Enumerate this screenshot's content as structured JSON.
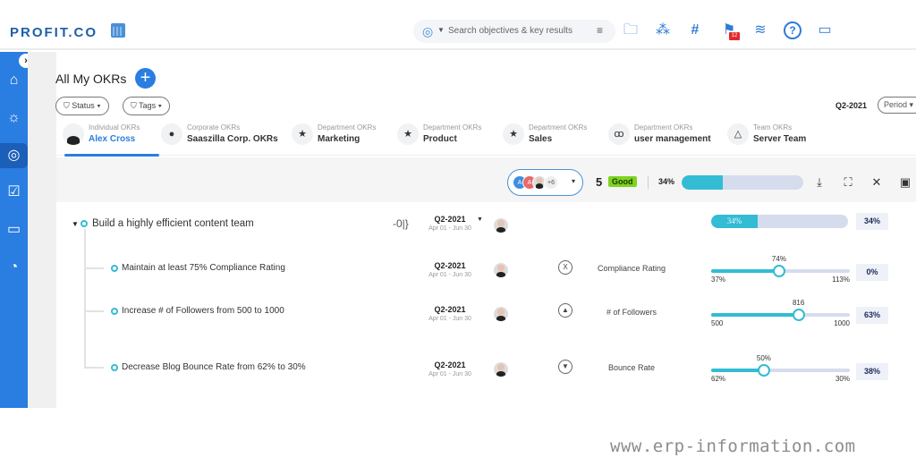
{
  "app": {
    "logo": "PROFIT.CO",
    "calendar_icon": "calendar-icon"
  },
  "header": {
    "search": {
      "scope_icon": "target-icon",
      "placeholder": "Search objectives & key results",
      "filter_icon": "filter-icon"
    },
    "icons": [
      "folder-search-icon",
      "hierarchy-icon",
      "hashtag-icon",
      "flag-notification-icon",
      "layers-icon",
      "help-icon",
      "chat-icon"
    ],
    "notification_count": "12"
  },
  "sidebar": {
    "toggle": "›",
    "items": [
      {
        "name": "home",
        "glyph": "⌂"
      },
      {
        "name": "ideas",
        "glyph": "☼"
      },
      {
        "name": "okrs",
        "glyph": "◎",
        "active": true
      },
      {
        "name": "tasks",
        "glyph": "☑"
      },
      {
        "name": "feedback",
        "glyph": "▭"
      },
      {
        "name": "dashboard",
        "glyph": "◔"
      }
    ]
  },
  "page": {
    "title": "All My OKRs",
    "add_label": "+"
  },
  "filters": {
    "status": "Status",
    "tags": "Tags",
    "period_value": "Q2-2021",
    "period_label": "Period"
  },
  "tabs": [
    {
      "sub": "Individual OKRs",
      "name": "Alex Cross",
      "icon": "avatar",
      "active": true
    },
    {
      "sub": "Corporate OKRs",
      "name": "Saaszilla Corp. OKRs",
      "icon": "globe-icon",
      "glyph": "●"
    },
    {
      "sub": "Department OKRs",
      "name": "Marketing",
      "icon": "star-icon",
      "glyph": "★"
    },
    {
      "sub": "Department OKRs",
      "name": "Product",
      "icon": "star-icon",
      "glyph": "★"
    },
    {
      "sub": "Department OKRs",
      "name": "Sales",
      "icon": "star-icon",
      "glyph": "★"
    },
    {
      "sub": "Department OKRs",
      "name": "user management",
      "icon": "users-icon",
      "glyph": "ꝏ"
    },
    {
      "sub": "Team OKRs",
      "name": "Server Team",
      "icon": "team-icon",
      "glyph": "△"
    }
  ],
  "summary": {
    "owners_more": "+6",
    "owner_initials": [
      "A",
      "A"
    ],
    "count": "5",
    "status": "Good",
    "progress_label": "34%",
    "progress": 34,
    "actions": [
      "download-icon",
      "presentation-icon",
      "collapse-icon",
      "comment-icon"
    ]
  },
  "objective": {
    "title": "Build a highly efficient content team",
    "period": "Q2-2021",
    "dates": "Apr 01 - Jun 30",
    "progress": 34,
    "progress_label": "34%",
    "score": "34%"
  },
  "key_results": [
    {
      "title": "Maintain at least 75% Compliance Rating",
      "period": "Q2-2021",
      "dates": "Apr 01 - Jun 30",
      "metric_icon": "target-range-icon",
      "metric_glyph": "X",
      "metric": "Compliance Rating",
      "start": "37%",
      "target": "113%",
      "current": "74%",
      "slider_fraction": 0.49,
      "score": "0%"
    },
    {
      "title": "Increase # of Followers from 500 to 1000",
      "period": "Q2-2021",
      "dates": "Apr 01 - Jun 30",
      "metric_icon": "increase-icon",
      "metric_glyph": "▲",
      "metric": "# of Followers",
      "start": "500",
      "target": "1000",
      "current": "816",
      "slider_fraction": 0.63,
      "score": "63%"
    },
    {
      "title": "Decrease Blog Bounce Rate from 62% to 30%",
      "period": "Q2-2021",
      "dates": "Apr 01 - Jun 30",
      "metric_icon": "decrease-icon",
      "metric_glyph": "▼",
      "metric": "Bounce Rate",
      "start": "62%",
      "target": "30%",
      "current": "50%",
      "slider_fraction": 0.38,
      "score": "38%"
    }
  ],
  "watermark": "www.erp-information.com"
}
